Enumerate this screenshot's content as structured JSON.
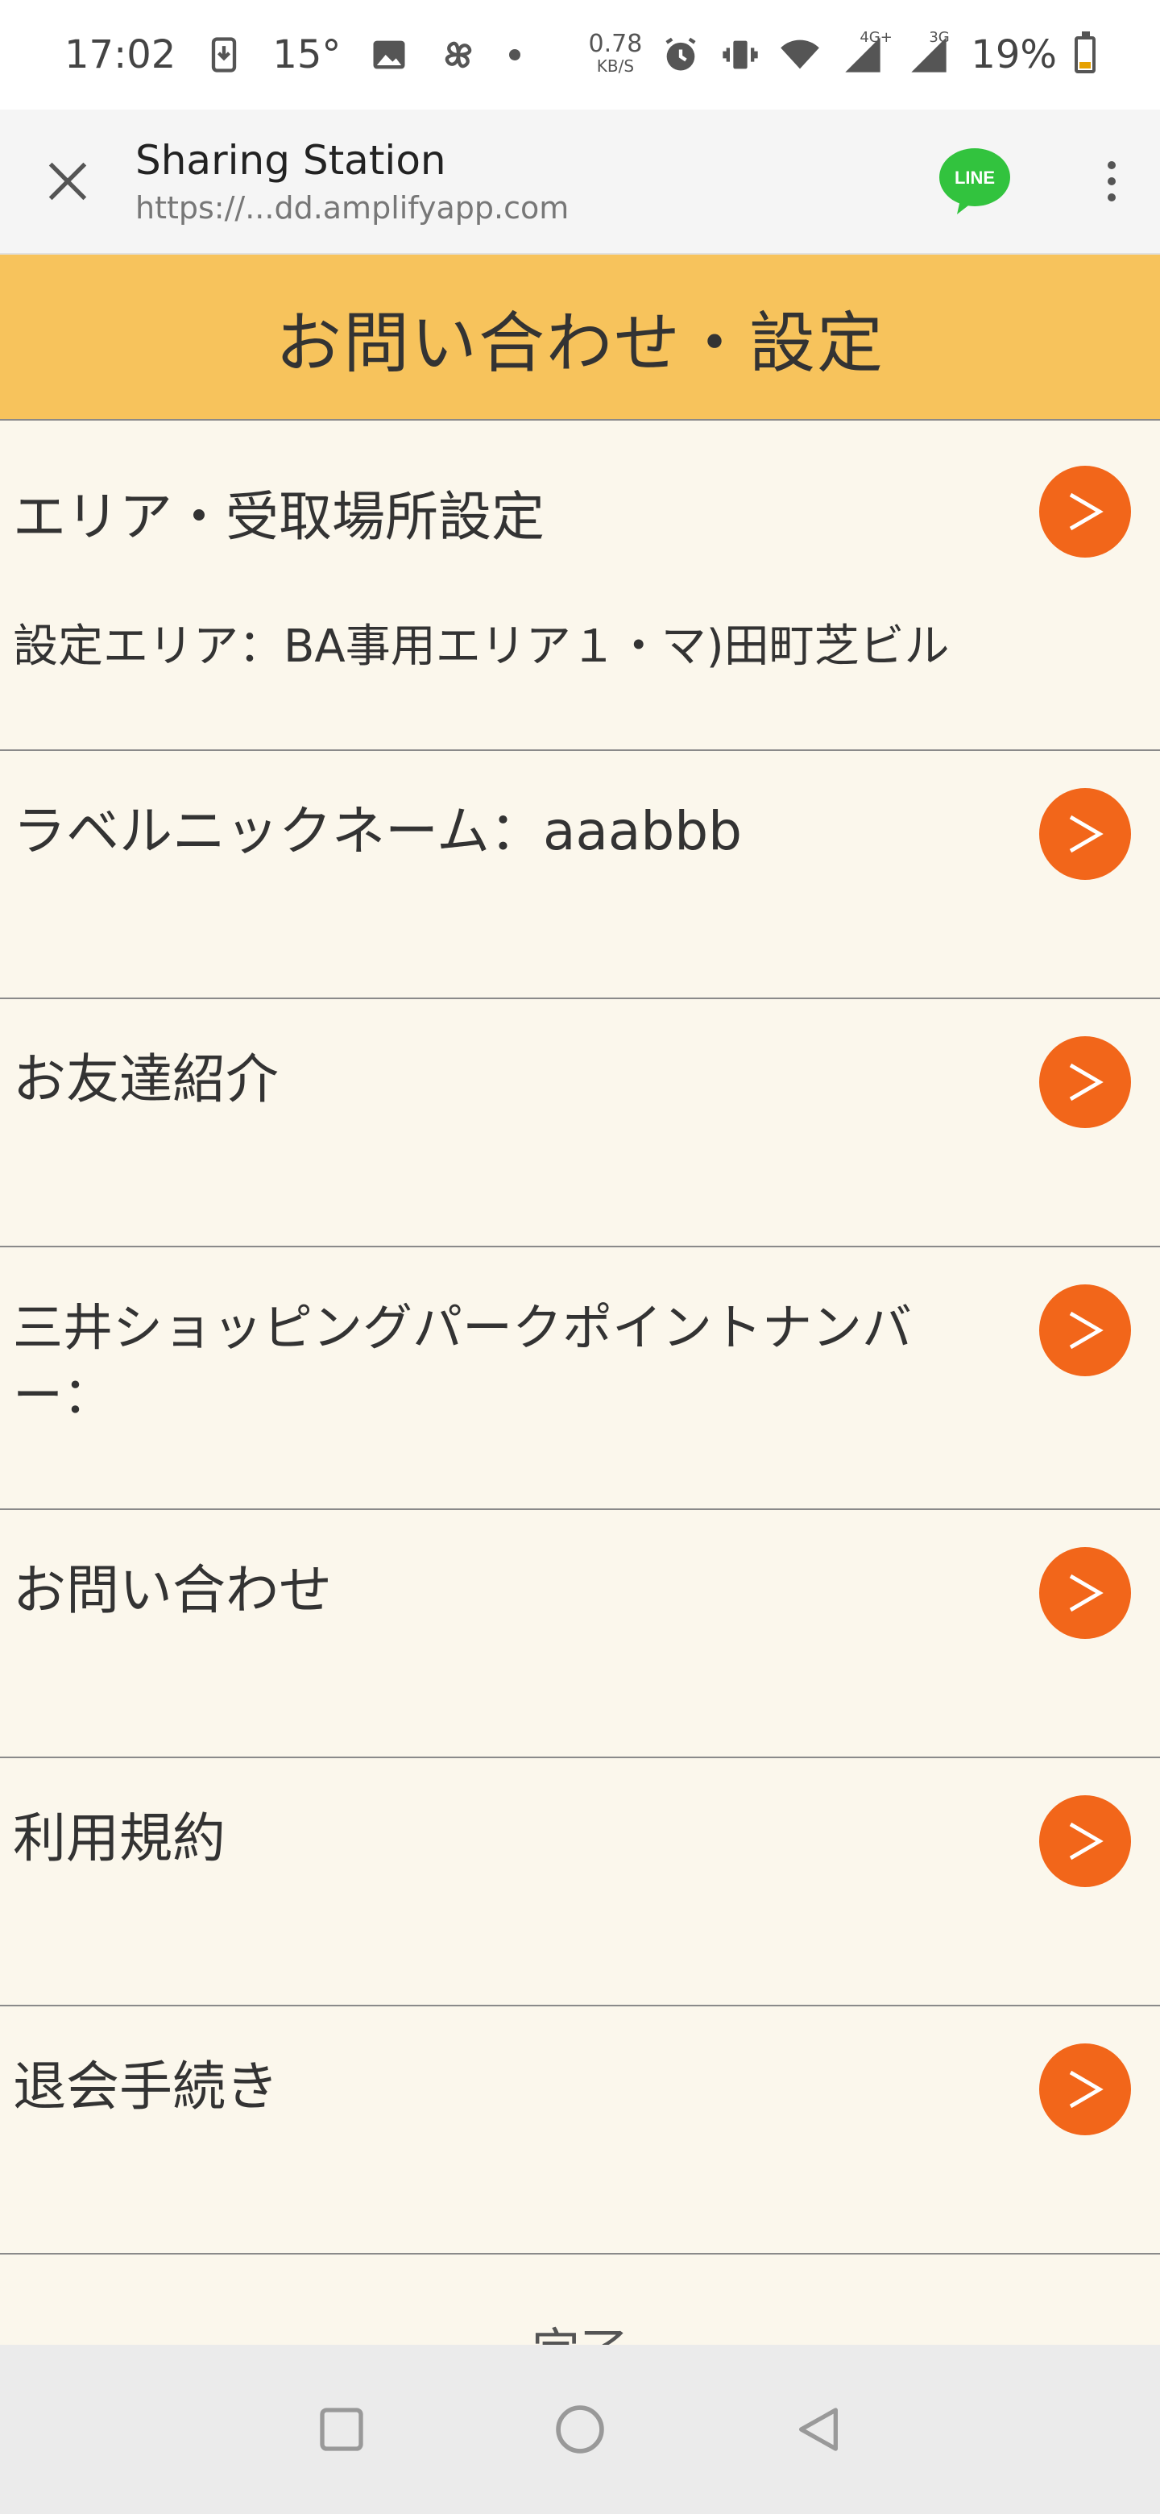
{
  "status_bar": {
    "time": "17:02",
    "temp": "15°",
    "net_speed": "0.78",
    "net_unit": "KB/S",
    "net_4g": "4G+",
    "net_3g": "3G",
    "battery": "19%"
  },
  "browser": {
    "title": "Sharing Station",
    "url": "https://...dd.amplifyapp.com",
    "line_label": "LINE"
  },
  "header": {
    "title": "お問い合わせ・設定"
  },
  "settings": {
    "area_label": "エリア・受取場所設定",
    "area_value": "設定エリア：BA事用エリア１・マ)田町芝ビル",
    "nickname": "ラベルニックネーム：aaabbb",
    "friend": "お友達紹介",
    "point_line1": "三井ショッピングパークポイントナンバ",
    "point_line2": "ー：",
    "contact": "お問い合わせ",
    "terms": "利用規約",
    "withdraw": "退会手続き",
    "arrow": ">"
  },
  "footer": {
    "partial": "完了"
  },
  "colors": {
    "header_bg": "#f7c35c",
    "arrow_bg": "#f2661a",
    "page_bg": "#fbf7ec",
    "line_green": "#32c33e"
  }
}
